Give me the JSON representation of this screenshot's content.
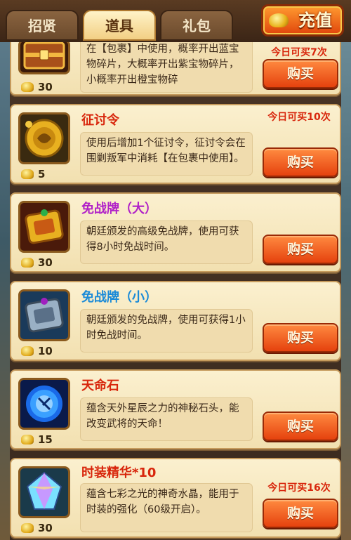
{
  "tabs": [
    {
      "label": "招贤",
      "active": false
    },
    {
      "label": "道具",
      "active": true
    },
    {
      "label": "礼包",
      "active": false
    }
  ],
  "recharge_label": "充值",
  "buy_label": "购买",
  "items": [
    {
      "name": "",
      "name_color": "#d8260c",
      "icon": "treasure-chest-icon",
      "price": "30",
      "desc": "在【包裹】中使用，概率开出蓝宝物碎片，大概率开出紫宝物碎片，小概率开出橙宝物碎",
      "limit": "今日可买7次"
    },
    {
      "name": "征讨令",
      "name_color": "#d8260c",
      "icon": "conquest-token-icon",
      "price": "5",
      "desc": "使用后增加1个征讨令，征讨令会在围剿叛军中消耗【在包裹中使用】。",
      "limit": "今日可买10次"
    },
    {
      "name": "免战牌（大）",
      "name_color": "#b020c8",
      "icon": "large-truce-plaque-icon",
      "price": "30",
      "desc": "朝廷颁发的高级免战牌，使用可获得8小时免战时间。",
      "limit": ""
    },
    {
      "name": "免战牌（小）",
      "name_color": "#1a8ad8",
      "icon": "small-truce-plaque-icon",
      "price": "10",
      "desc": "朝廷颁发的免战牌，使用可获得1小时免战时间。",
      "limit": ""
    },
    {
      "name": "天命石",
      "name_color": "#d8260c",
      "icon": "destiny-stone-icon",
      "price": "15",
      "desc": "蕴含天外星辰之力的神秘石头，能改变武将的天命！",
      "limit": ""
    },
    {
      "name": "时装精华*10",
      "name_color": "#d8260c",
      "icon": "costume-essence-crystal-icon",
      "price": "30",
      "desc": "蕴含七彩之光的神奇水晶，能用于时装的强化（60级开启）。",
      "limit": "今日可买16次"
    }
  ]
}
